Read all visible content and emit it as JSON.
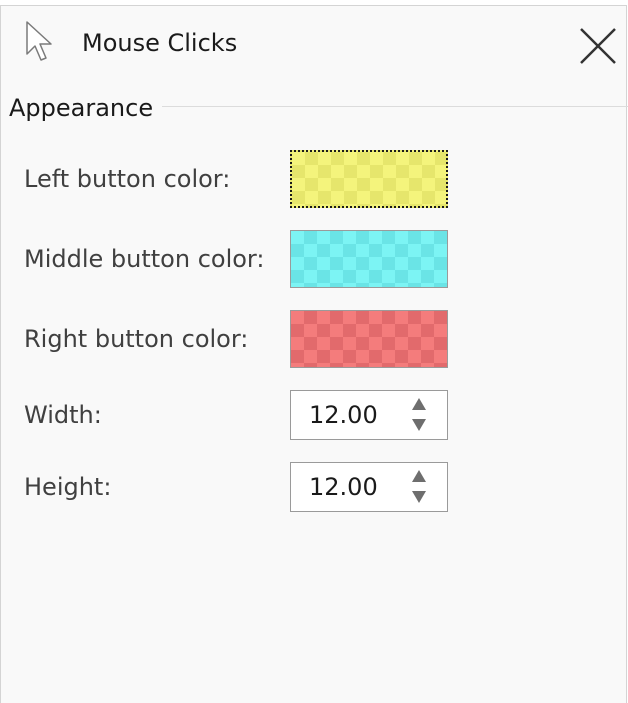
{
  "window": {
    "title": "Mouse Clicks",
    "title_icon": "cursor-arrow-icon",
    "close_icon": "close-icon"
  },
  "appearance": {
    "section_title": "Appearance",
    "left_button": {
      "label": "Left button color:",
      "color": "#f4f47c",
      "color_dark": "#e6e66c"
    },
    "middle_button": {
      "label": "Middle button color:",
      "color": "#7cf4f4",
      "color_dark": "#6ae4e6"
    },
    "right_button": {
      "label": "Right button color:",
      "color": "#f47c7c",
      "color_dark": "#e26a6c"
    },
    "width": {
      "label": "Width:",
      "value": "12.00"
    },
    "height": {
      "label": "Height:",
      "value": "12.00"
    }
  }
}
